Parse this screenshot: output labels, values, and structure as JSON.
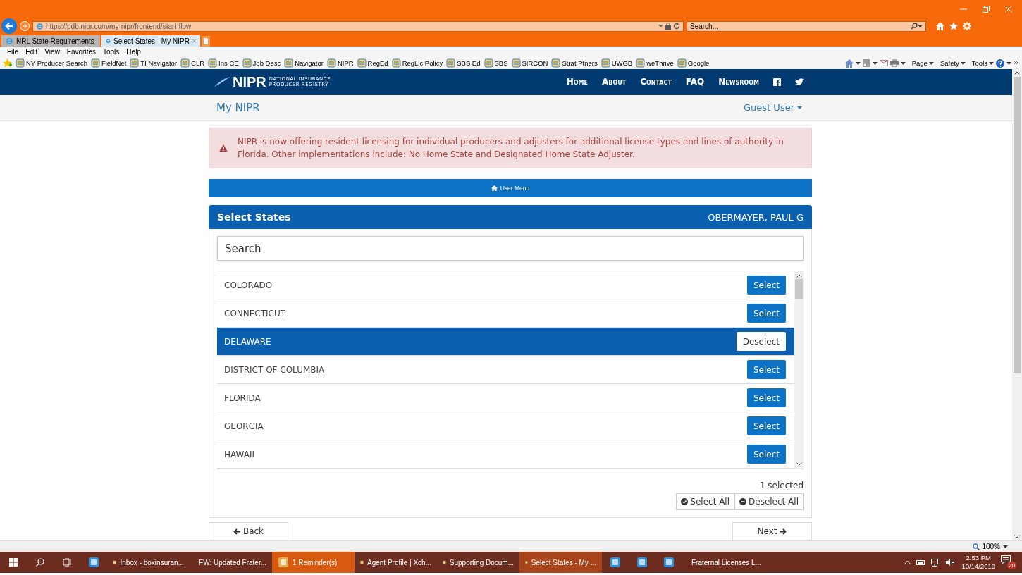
{
  "browser": {
    "address": "https://pdb.nipr.com/my-nipr/frontend/start-flow",
    "search_placeholder": "Search...",
    "tabs": [
      {
        "label": "NRL State Requirements",
        "selected": false
      },
      {
        "label": "Select States - My NIPR",
        "selected": true
      }
    ],
    "menu": [
      "File",
      "Edit",
      "View",
      "Favorites",
      "Tools",
      "Help"
    ],
    "favorites": [
      "NY Producer Search",
      "FieldNet",
      "TI Navigator",
      "CLR",
      "Ins CE",
      "Job Desc",
      "Navigator",
      "NIPR",
      "RegEd",
      "RegLic Policy",
      "SBS Ed",
      "SBS",
      "SIRCON",
      "Strat Ptners",
      "UWGB",
      "weThrive",
      "Google"
    ],
    "commands": [
      "Page",
      "Safety",
      "Tools"
    ],
    "zoom": "100%"
  },
  "site": {
    "brand": "NIPR",
    "brand_line_1": "NATIONAL INSURANCE",
    "brand_line_2": "PRODUCER REGISTRY",
    "nav": [
      "Home",
      "About",
      "Contact",
      "FAQ",
      "Newsroom"
    ],
    "title": "My NIPR",
    "user_menu": "Guest User",
    "alert": "NIPR is now offering resident licensing for individual producers and adjusters for additional license types and lines of authority in Florida. Other implementations include: No Home State and Designated Home State Adjuster.",
    "menu_bar": "User Menu",
    "panel": {
      "title": "Select States",
      "user": "OBERMAYER, PAUL G",
      "search_placeholder": "Search",
      "states": [
        {
          "name": "COLORADO",
          "button": "Select",
          "selected": false
        },
        {
          "name": "CONNECTICUT",
          "button": "Select",
          "selected": false
        },
        {
          "name": "DELAWARE",
          "button": "Deselect",
          "selected": true
        },
        {
          "name": "DISTRICT OF COLUMBIA",
          "button": "Select",
          "selected": false
        },
        {
          "name": "FLORIDA",
          "button": "Select",
          "selected": false
        },
        {
          "name": "GEORGIA",
          "button": "Select",
          "selected": false
        },
        {
          "name": "HAWAII",
          "button": "Select",
          "selected": false
        }
      ],
      "count": "1 selected",
      "select_all": "Select All",
      "deselect_all": "Deselect All",
      "back": "Back",
      "next": "Next"
    }
  },
  "taskbar": {
    "items": [
      {
        "kind": "icon",
        "selected": false,
        "flashing": false
      },
      {
        "kind": "app",
        "label": "Inbox - boxinsuran...",
        "selected": false,
        "flashing": false
      },
      {
        "kind": "app",
        "label": "FW: Updated Frater...",
        "selected": false,
        "flashing": false
      },
      {
        "kind": "app",
        "label": "1 Reminder(s)",
        "selected": false,
        "flashing": true
      },
      {
        "kind": "app",
        "label": "Agent Profile | Xch...",
        "selected": false,
        "flashing": false
      },
      {
        "kind": "app",
        "label": "Supporting Docum...",
        "selected": false,
        "flashing": false
      },
      {
        "kind": "app",
        "label": "Select States - My ...",
        "selected": true,
        "flashing": false
      },
      {
        "kind": "icon",
        "selected": false,
        "flashing": false
      },
      {
        "kind": "icon",
        "selected": false,
        "flashing": false
      },
      {
        "kind": "icon",
        "selected": false,
        "flashing": false
      },
      {
        "kind": "app",
        "label": "Fraternal Licenses L...",
        "selected": false,
        "flashing": false
      }
    ],
    "time": "2:53 PM",
    "date": "10/14/2019",
    "notifications": "20"
  }
}
